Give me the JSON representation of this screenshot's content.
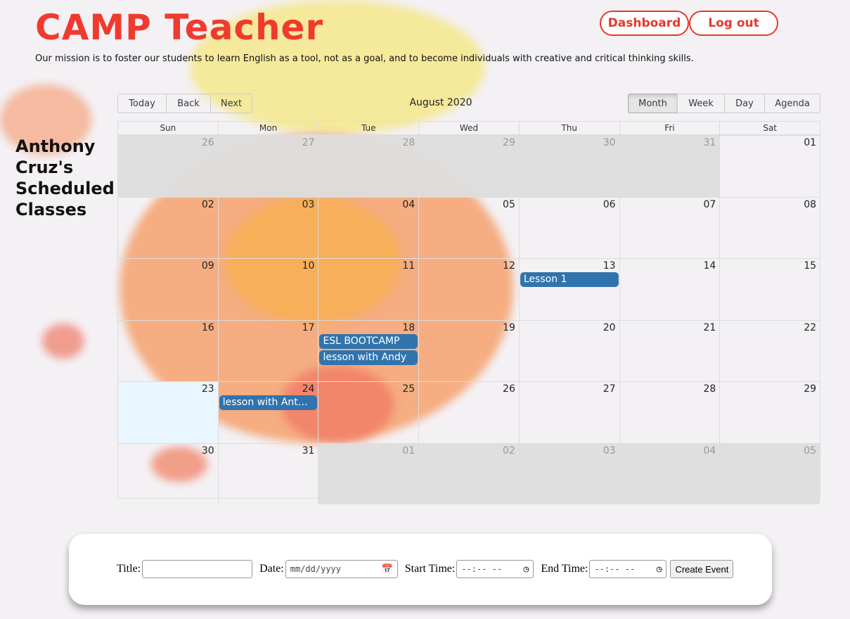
{
  "header": {
    "brand": "CAMP Teacher",
    "mission": "Our mission is to foster our students to learn English as a tool, not as a goal, and to become individuals with creative and critical thinking skills.",
    "dashboard_label": "Dashboard",
    "logout_label": "Log out"
  },
  "sidebar": {
    "title": "Anthony Cruz's Scheduled Classes"
  },
  "calendar": {
    "nav": {
      "today": "Today",
      "back": "Back",
      "next": "Next"
    },
    "label": "August 2020",
    "views": {
      "month": "Month",
      "week": "Week",
      "day": "Day",
      "agenda": "Agenda"
    },
    "active_view": "Month",
    "weekdays": [
      "Sun",
      "Mon",
      "Tue",
      "Wed",
      "Thu",
      "Fri",
      "Sat"
    ],
    "weeks": [
      [
        "26",
        "27",
        "28",
        "29",
        "30",
        "31",
        "01"
      ],
      [
        "02",
        "03",
        "04",
        "05",
        "06",
        "07",
        "08"
      ],
      [
        "09",
        "10",
        "11",
        "12",
        "13",
        "14",
        "15"
      ],
      [
        "16",
        "17",
        "18",
        "19",
        "20",
        "21",
        "22"
      ],
      [
        "23",
        "24",
        "25",
        "26",
        "27",
        "28",
        "29"
      ],
      [
        "30",
        "31",
        "01",
        "02",
        "03",
        "04",
        "05"
      ]
    ],
    "events": {
      "w2_thu": "Lesson 1",
      "w3_tue_a": "ESL BOOTCAMP",
      "w3_tue_b": "lesson with Andy",
      "w4_mon": "lesson with Antho..."
    },
    "colors": {
      "event": "#3174ad",
      "off_range": "#dddddd",
      "today": "#eaf6ff"
    }
  },
  "form": {
    "title_label": "Title:",
    "title_value": "",
    "date_label": "Date:",
    "date_placeholder": "mm/dd/yyyy",
    "start_label": "Start Time:",
    "start_placeholder": "--:-- --",
    "end_label": "End Time:",
    "end_placeholder": "--:-- --",
    "submit_label": "Create Event"
  },
  "icons": {
    "calendar": "calendar-icon",
    "clock": "clock-icon"
  },
  "colors": {
    "brand": "#f03a2e",
    "background": "#f4f1f5"
  }
}
